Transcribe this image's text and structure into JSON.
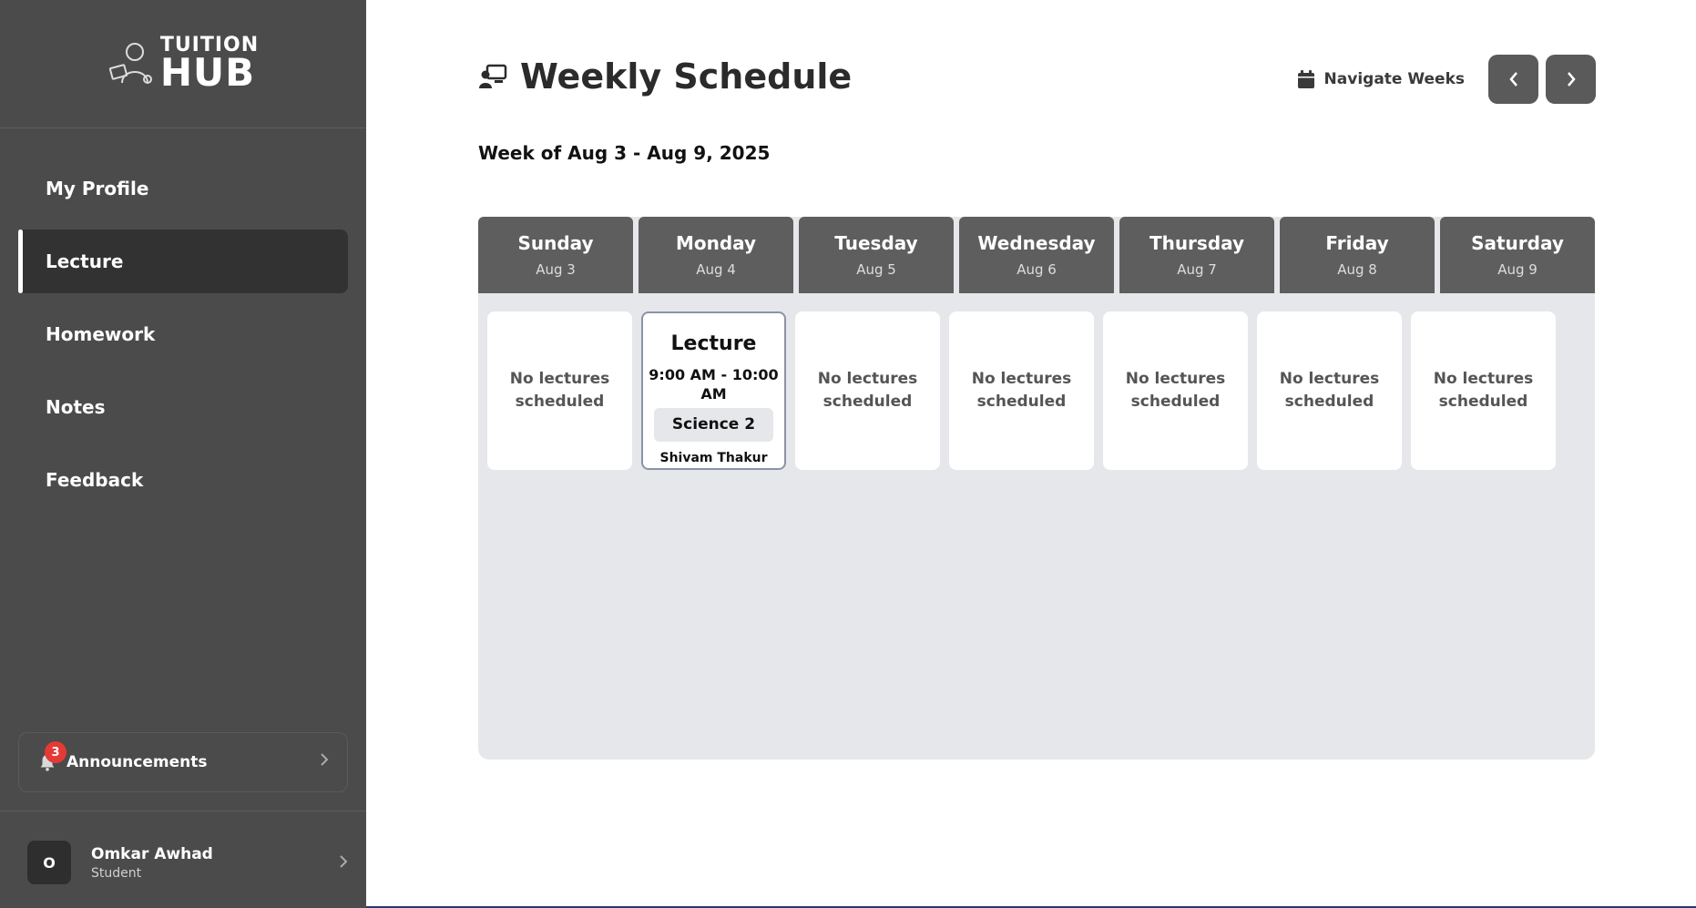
{
  "brand": {
    "line1": "TUITION",
    "line2": "HUB"
  },
  "sidebar": {
    "items": [
      {
        "label": "My Profile",
        "active": false
      },
      {
        "label": "Lecture",
        "active": true
      },
      {
        "label": "Homework",
        "active": false
      },
      {
        "label": "Notes",
        "active": false
      },
      {
        "label": "Feedback",
        "active": false
      }
    ],
    "announcements": {
      "label": "Announcements",
      "count": "3"
    },
    "user": {
      "initial": "O",
      "name": "Omkar Awhad",
      "role": "Student"
    }
  },
  "header": {
    "title": "Weekly Schedule",
    "navigate_label": "Navigate Weeks",
    "prev_icon": "chevron-left-icon",
    "next_icon": "chevron-right-icon"
  },
  "week_label": "Week of Aug 3 - Aug 9, 2025",
  "days": [
    {
      "name": "Sunday",
      "date": "Aug 3"
    },
    {
      "name": "Monday",
      "date": "Aug 4"
    },
    {
      "name": "Tuesday",
      "date": "Aug 5"
    },
    {
      "name": "Wednesday",
      "date": "Aug 6"
    },
    {
      "name": "Thursday",
      "date": "Aug 7"
    },
    {
      "name": "Friday",
      "date": "Aug 8"
    },
    {
      "name": "Saturday",
      "date": "Aug 9"
    }
  ],
  "empty_text_line1": "No lectures",
  "empty_text_line2": "scheduled",
  "lecture": {
    "title": "Lecture",
    "time_line1": "9:00 AM - 10:00",
    "time_line2": "AM",
    "subject": "Science 2",
    "teacher": "Shivam Thakur"
  },
  "colors": {
    "sidebar_bg": "#4b4b4b",
    "active_item_bg": "#323232",
    "header_bg": "#5e5e5e",
    "grid_bg": "#e6e7ea",
    "badge": "#e53935"
  }
}
